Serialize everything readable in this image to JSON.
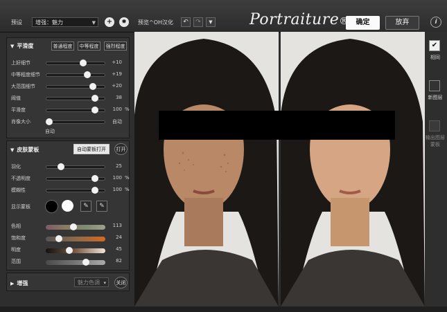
{
  "toolbar": {
    "preset_label": "预设",
    "preset_value": "增强：魅力",
    "add_icon": "plus-icon",
    "settings_icon": "gear-icon",
    "preview_label": "预览^OH汉化",
    "undo_icon": "undo-icon",
    "redo_icon": "redo-icon",
    "history_icon": "chevron-down-icon",
    "app_title": "Portraiture",
    "app_version": "® 3",
    "ok_label": "确定",
    "cancel_label": "放弃",
    "help_label": "i"
  },
  "smoothing": {
    "header": "平滑度",
    "btn_normal": "普通程度",
    "btn_medium": "中等程度",
    "btn_strong": "强烈程度",
    "sliders": [
      {
        "label": "上好细节",
        "value": "+10",
        "unit": "",
        "level": 0.63
      },
      {
        "label": "中等程度细节",
        "value": "+19",
        "unit": "",
        "level": 0.7
      },
      {
        "label": "大范围细节",
        "value": "+20",
        "unit": "",
        "level": 0.8
      },
      {
        "label": "阈值",
        "value": "38",
        "unit": "",
        "level": 0.83
      },
      {
        "label": "平滑度",
        "value": "100",
        "unit": "%",
        "level": 0.83
      },
      {
        "label": "肖像大小",
        "value": "自动",
        "unit": "",
        "level": 0.05
      }
    ],
    "auto_label": "自动"
  },
  "skin_mask": {
    "header": "皮肤蒙板",
    "auto_mask_label": "自动蒙板打开",
    "on_label": "打开",
    "sliders": [
      {
        "label": "羽化",
        "value": "25",
        "unit": "",
        "level": 0.25
      },
      {
        "label": "不透明度",
        "value": "100",
        "unit": "%",
        "level": 0.83
      },
      {
        "label": "模糊性",
        "value": "100",
        "unit": "%",
        "level": 0.83
      }
    ],
    "display_label": "显示蒙板",
    "swatch_black": "#000000",
    "swatch_white": "#ffffff",
    "eyedropper_icon": "eyedropper-icon",
    "eyedropper_plus_icon": "eyedropper-plus-icon",
    "color_sliders": [
      {
        "label": "色相",
        "value": "113",
        "level": 0.47
      },
      {
        "label": "饱和度",
        "value": "24",
        "level": 0.22
      },
      {
        "label": "明度",
        "value": "45",
        "level": 0.4
      },
      {
        "label": "范围",
        "value": "82",
        "level": 0.67
      }
    ]
  },
  "enhance": {
    "header": "增强",
    "dropdown_value": "魅力色调",
    "off_label": "关闭"
  },
  "right_panel": {
    "same_label": "相同",
    "new_layer_label": "新图层",
    "output_mask_label": "输出图层蒙板"
  },
  "colors": {
    "accent_text": "#f2f2f2",
    "panel_bg": "#353535"
  }
}
